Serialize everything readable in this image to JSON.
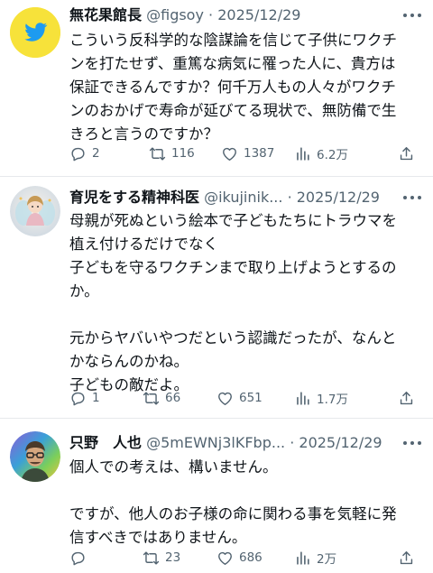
{
  "tweets": [
    {
      "author_name": "無花果館長",
      "handle": "@figsoy",
      "separator": "·",
      "date": "2025/12/29",
      "avatar_icon": "bird-logo-icon",
      "body_lines": [
        "こういう反科学的な陰謀論を信じて子供にワクチ",
        "ンを打たせず、重篤な病気に罹った人に、貴方は",
        "保証できるんですか？何千万人もの人々がワクチ",
        "ンのおかげで寿命が延びてる現状で、無防備で生",
        "きろと言うのですか？"
      ],
      "replies": "2",
      "reposts": "116",
      "likes": "1387",
      "views": "6.2万"
    },
    {
      "author_name": "育児をする精神科医",
      "handle": "@ikujinik...",
      "separator": "·",
      "date": "2025/12/29",
      "avatar_icon": "fairy-illustration-avatar",
      "body_lines": [
        "母親が死ぬという絵本で子どもたちにトラウマを",
        "植え付けるだけでなく",
        "子どもを守るワクチンまで取り上げようとするの",
        "か。",
        "",
        "元からヤバいやつだという認識だったが、なんと",
        "かならんのかね。",
        "子どもの敵だよ。"
      ],
      "replies": "1",
      "reposts": "66",
      "likes": "651",
      "views": "1.7万"
    },
    {
      "author_name": "只野　人也",
      "handle": "@5mEWNj3lKFbp...",
      "separator": "·",
      "date": "2025/12/29",
      "avatar_icon": "man-portrait-avatar",
      "body_lines": [
        "個人での考えは、構いません。",
        "",
        "ですが、他人のお子様の命に関わる事を気軽に発",
        "信すべきではありません。"
      ],
      "replies": "",
      "reposts": "23",
      "likes": "686",
      "views": "2万"
    }
  ],
  "colors": {
    "text": "#0f1419",
    "secondary": "#536471",
    "divider": "#e6e9ec",
    "twitter_blue": "#1d9bf0",
    "yellow_avatar": "#f7e23a"
  },
  "icons": {
    "reply": "speech-bubble-icon",
    "repost": "repost-arrows-icon",
    "like": "heart-icon",
    "views": "bar-chart-icon",
    "share": "share-upload-icon",
    "more": "more-dots-icon"
  }
}
